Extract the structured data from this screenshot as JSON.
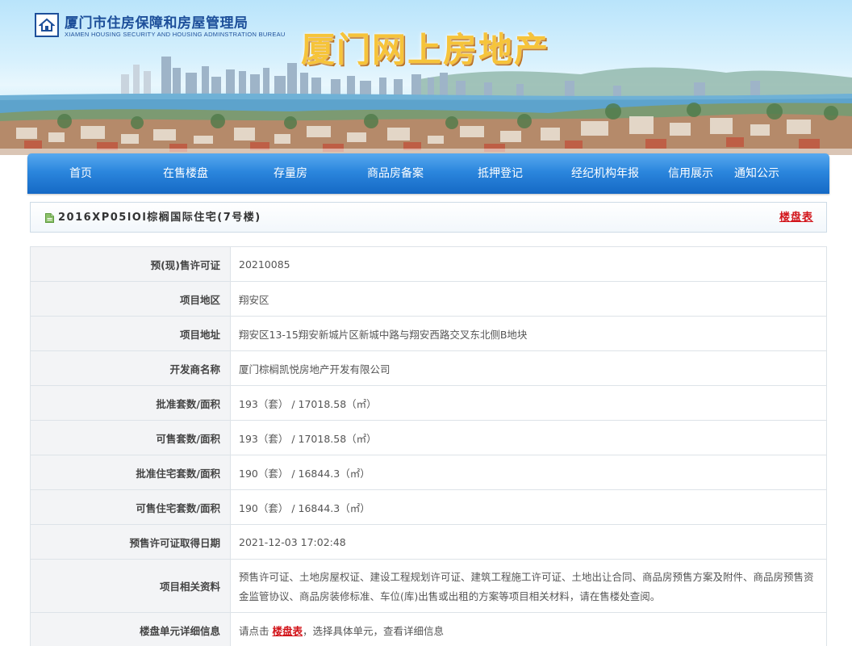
{
  "header": {
    "bureau_cn": "厦门市住房保障和房屋管理局",
    "bureau_en": "XIAMEN HOUSING SECURITY AND HOUSING ADMINSTRATION BUREAU",
    "site_title": "厦门网上房地产"
  },
  "nav": {
    "items": [
      {
        "label": "首页"
      },
      {
        "label": "在售楼盘"
      },
      {
        "label": "存量房"
      },
      {
        "label": "商品房备案"
      },
      {
        "label": "抵押登记"
      },
      {
        "label": "经纪机构年报"
      },
      {
        "label": "信用展示"
      },
      {
        "label": "通知公示"
      }
    ]
  },
  "project": {
    "title": "2016XP05lOl棕榈国际住宅(7号楼)",
    "table_link": "楼盘表"
  },
  "info": {
    "rows": [
      {
        "label": "预(现)售许可证",
        "value": "20210085"
      },
      {
        "label": "项目地区",
        "value": "翔安区"
      },
      {
        "label": "项目地址",
        "value": "翔安区13-15翔安新城片区新城中路与翔安西路交叉东北侧B地块"
      },
      {
        "label": "开发商名称",
        "value": "厦门棕榈凯悦房地产开发有限公司"
      },
      {
        "label": "批准套数/面积",
        "value": "193（套） / 17018.58（㎡）"
      },
      {
        "label": "可售套数/面积",
        "value": "193（套） / 17018.58（㎡）"
      },
      {
        "label": "批准住宅套数/面积",
        "value": "190（套） / 16844.3（㎡）"
      },
      {
        "label": "可售住宅套数/面积",
        "value": "190（套） / 16844.3（㎡）"
      },
      {
        "label": "预售许可证取得日期",
        "value": "2021-12-03 17:02:48"
      },
      {
        "label": "项目相关资料",
        "value": "预售许可证、土地房屋权证、建设工程规划许可证、建筑工程施工许可证、土地出让合同、商品房预售方案及附件、商品房预售资金监管协议、商品房装修标准、车位(库)出售或出租的方案等项目相关材料，请在售楼处查阅。"
      },
      {
        "label": "楼盘单元详细信息",
        "value_prefix": "请点击",
        "value_link": "楼盘表",
        "value_suffix": "，选择具体单元，查看详细信息"
      }
    ]
  }
}
